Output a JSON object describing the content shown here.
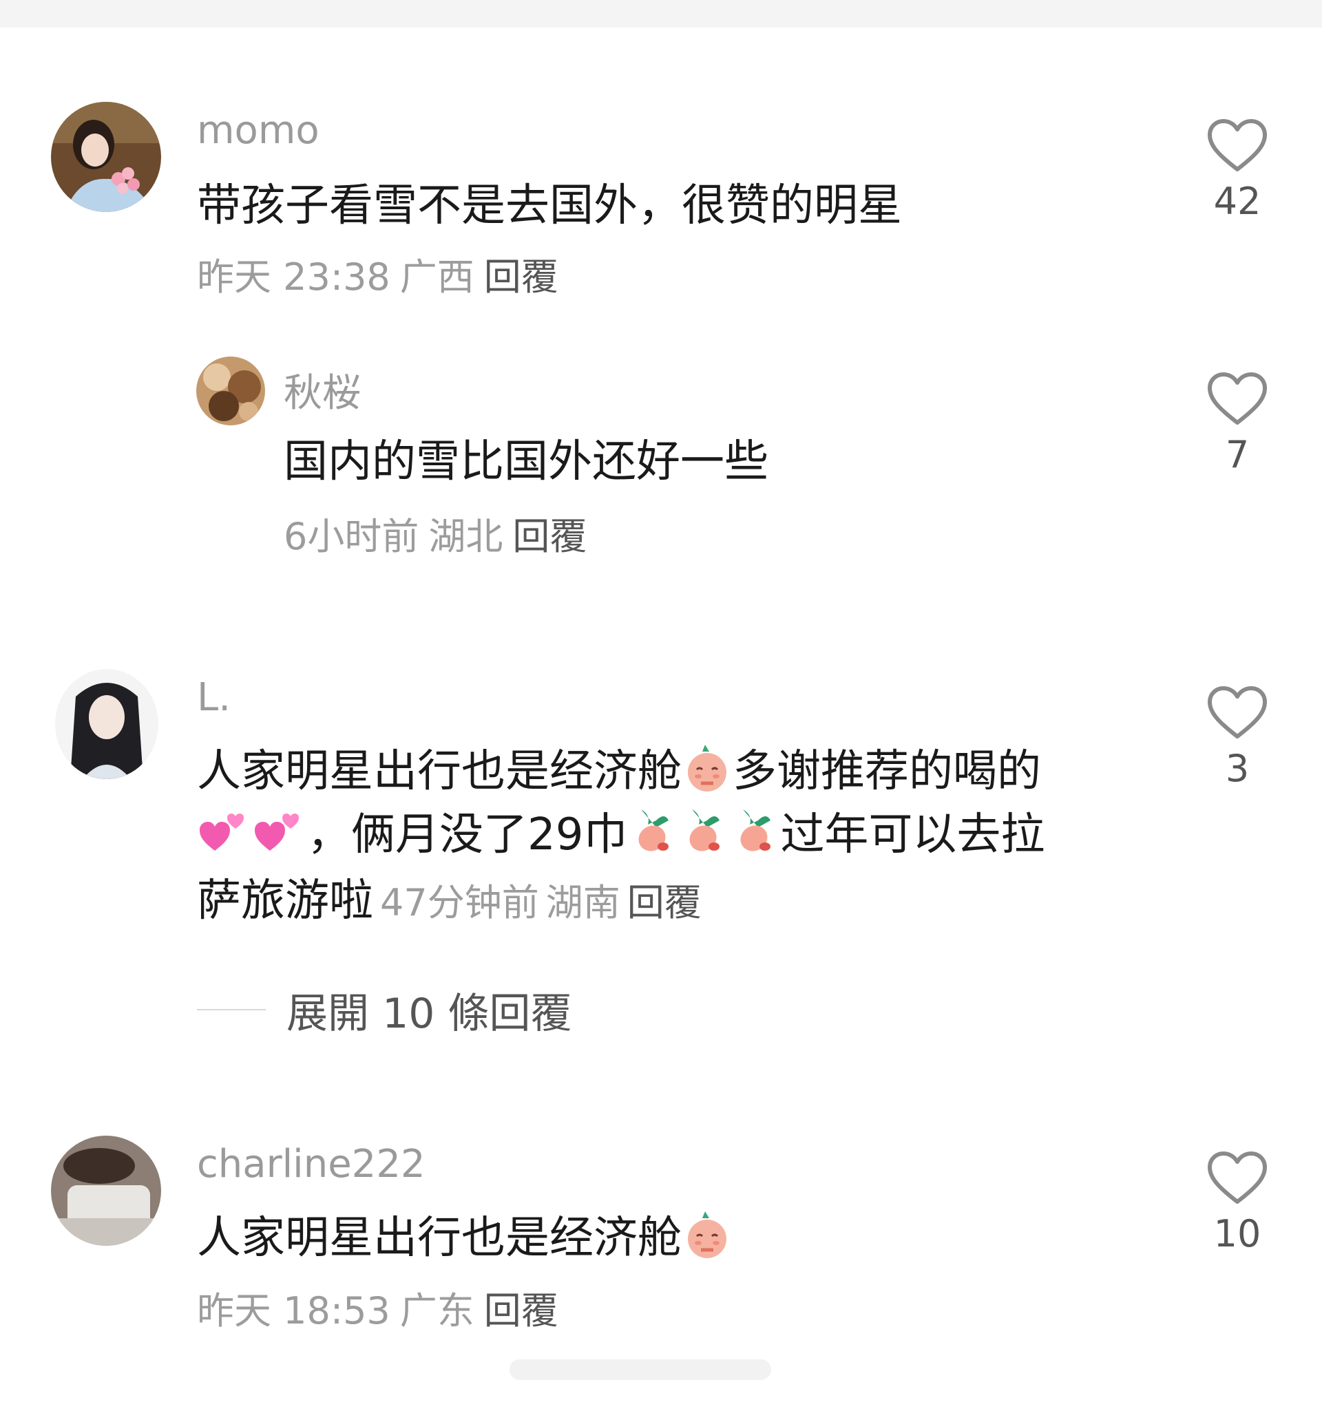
{
  "comments": [
    {
      "username": "momo",
      "text": "带孩子看雪不是去国外，很赞的明星",
      "time": "昨天 23:38",
      "location": "广西",
      "reply_label": "回覆",
      "likes": "42",
      "replies": [
        {
          "username": "秋桜",
          "text": "国内的雪比国外还好一些",
          "time": "6小时前",
          "location": "湖北",
          "reply_label": "回覆",
          "likes": "7"
        }
      ]
    },
    {
      "username": "L.",
      "text_part1": "人家明星出行也是经济舱",
      "text_part2": "多谢推荐的喝的",
      "text_part3": "，俩月没了29巾",
      "text_part4": "过年可以去拉",
      "text_part5": "萨旅游啦",
      "time": "47分钟前",
      "location": "湖南",
      "reply_label": "回覆",
      "likes": "3",
      "expand_label": "展開 10 條回覆"
    },
    {
      "username": "charline222",
      "text": "人家明星出行也是经济舱",
      "time": "昨天 18:53",
      "location": "广东",
      "reply_label": "回覆",
      "likes": "10"
    }
  ],
  "icons": {
    "like": "heart-outline-icon",
    "emoji_praying": "praying-radish-emoji",
    "emoji_hearts": "pink-hearts-emoji",
    "emoji_radish": "radish-emoji"
  },
  "colors": {
    "text": "#1a1a1a",
    "username": "#9a9a9a",
    "meta": "#9c9c9c",
    "heart_stroke": "#8a8a8a"
  }
}
